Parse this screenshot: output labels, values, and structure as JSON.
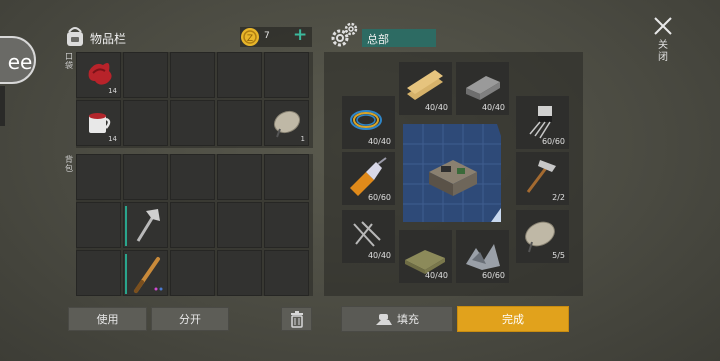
{
  "inventory": {
    "title": "物品栏",
    "coins": "7",
    "add_symbol": "+",
    "section_pocket": "口袋",
    "section_backpack": "背包",
    "pocket_items": [
      {
        "icon": "red-cloth-icon",
        "count": "14"
      },
      {
        "icon": "tea-cup-icon",
        "count": "14"
      },
      {
        "icon": "satellite-dish-icon",
        "count": "1"
      }
    ]
  },
  "buttons": {
    "use": "使用",
    "split": "分开",
    "fill": "填充",
    "done": "完成",
    "close": "关闭"
  },
  "crafting": {
    "category": "总部",
    "slots": [
      {
        "icon": "wood-planks-icon",
        "count": "40/40"
      },
      {
        "icon": "metal-ingot-icon",
        "count": "40/40"
      },
      {
        "icon": "wire-coil-icon",
        "count": "40/40"
      },
      {
        "icon": "transistor-icon",
        "count": "60/60"
      },
      {
        "icon": "glue-bottle-icon",
        "count": "60/60"
      },
      {
        "icon": "hammer-icon",
        "count": "2/2"
      },
      {
        "icon": "nails-icon",
        "count": "40/40"
      },
      {
        "icon": "satellite-dish-icon",
        "count": "5/5"
      },
      {
        "icon": "cloth-icon",
        "count": "40/40"
      },
      {
        "icon": "scrap-metal-icon",
        "count": "60/60"
      }
    ]
  },
  "colors": {
    "done_button": "#e1a21c",
    "category_bg": "#2d6b63",
    "blueprint": "#2e4a78"
  }
}
